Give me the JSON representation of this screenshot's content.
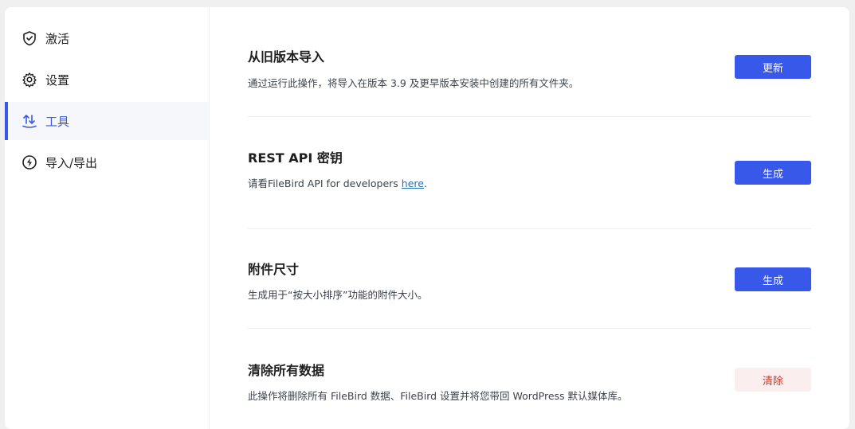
{
  "sidebar": {
    "items": [
      {
        "label": "激活",
        "icon": "shield-check-icon"
      },
      {
        "label": "设置",
        "icon": "gear-icon"
      },
      {
        "label": "工具",
        "icon": "arrows-up-down-icon",
        "active": true
      },
      {
        "label": "导入/导出",
        "icon": "lightning-icon"
      }
    ]
  },
  "sections": [
    {
      "title": "从旧版本导入",
      "description": "通过运行此操作，将导入在版本 3.9 及更早版本安装中创建的所有文件夹。",
      "button_label": "更新"
    },
    {
      "title": "REST API 密钥",
      "description_prefix": "请看FileBird API for developers ",
      "description_link": "here",
      "description_suffix": ".",
      "button_label": "生成"
    },
    {
      "title": "附件尺寸",
      "description": "生成用于“按大小排序”功能的附件大小。",
      "button_label": "生成"
    },
    {
      "title": "清除所有数据",
      "description": "此操作将删除所有 FileBird 数据、FileBird 设置并将您带回 WordPress 默认媒体库。",
      "button_label": "清除"
    }
  ],
  "colors": {
    "accent": "#3858e9",
    "danger_bg": "#fbeeee",
    "danger_text": "#c0392b"
  }
}
